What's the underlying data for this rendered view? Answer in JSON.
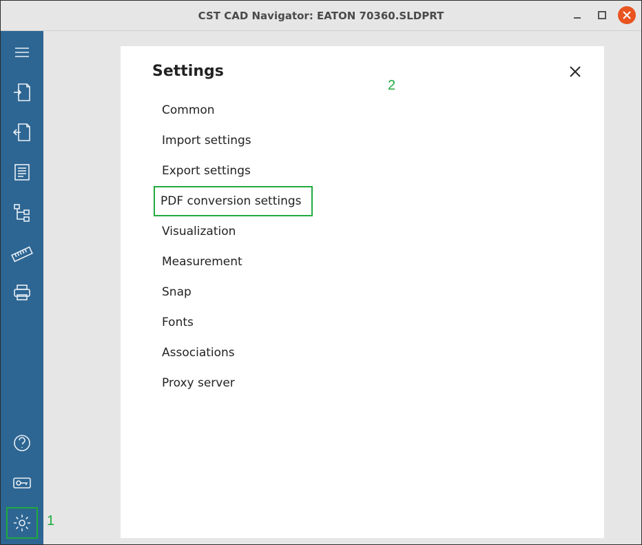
{
  "window": {
    "title": "CST CAD Navigator: EATON 70360.SLDPRT"
  },
  "sidebar": {
    "top": [
      {
        "name": "menu-icon"
      },
      {
        "name": "import-icon"
      },
      {
        "name": "export-icon"
      },
      {
        "name": "properties-icon"
      },
      {
        "name": "tree-icon"
      },
      {
        "name": "measure-icon"
      },
      {
        "name": "print-icon"
      }
    ],
    "bottom": [
      {
        "name": "help-icon"
      },
      {
        "name": "license-icon"
      },
      {
        "name": "settings-icon",
        "selected": true
      }
    ]
  },
  "panel": {
    "title": "Settings",
    "items": [
      {
        "label": "Common"
      },
      {
        "label": "Import settings"
      },
      {
        "label": "Export settings"
      },
      {
        "label": "PDF conversion settings",
        "highlighted": true
      },
      {
        "label": "Visualization"
      },
      {
        "label": "Measurement"
      },
      {
        "label": "Snap"
      },
      {
        "label": "Fonts"
      },
      {
        "label": "Associations"
      },
      {
        "label": "Proxy server"
      }
    ]
  },
  "annotations": {
    "a1": "1",
    "a2": "2"
  }
}
